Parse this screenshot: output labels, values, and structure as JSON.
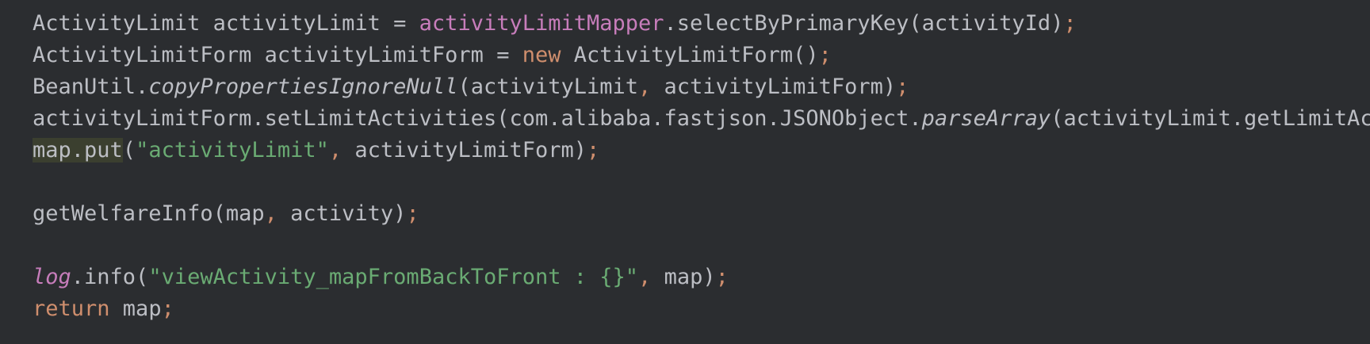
{
  "editor": {
    "colors": {
      "background": "#2b2d30",
      "plain": "#bcbec4",
      "field": "#c77dbb",
      "keyword": "#cf8e6d",
      "string": "#6aab73",
      "highlight": "#3b3f2f"
    },
    "lines": [
      {
        "tokens": [
          {
            "text": "ActivityLimit activityLimit = ",
            "kind": "plain"
          },
          {
            "text": "activityLimitMapper",
            "kind": "field"
          },
          {
            "text": ".selectByPrimaryKey(activityId)",
            "kind": "plain"
          },
          {
            "text": ";",
            "kind": "punct"
          }
        ]
      },
      {
        "tokens": [
          {
            "text": "ActivityLimitForm activityLimitForm = ",
            "kind": "plain"
          },
          {
            "text": "new",
            "kind": "kw"
          },
          {
            "text": " ActivityLimitForm()",
            "kind": "plain"
          },
          {
            "text": ";",
            "kind": "punct"
          }
        ]
      },
      {
        "tokens": [
          {
            "text": "BeanUtil.",
            "kind": "plain"
          },
          {
            "text": "copyPropertiesIgnoreNull",
            "kind": "italic"
          },
          {
            "text": "(activityLimit",
            "kind": "plain"
          },
          {
            "text": ",",
            "kind": "punct"
          },
          {
            "text": " activityLimitForm)",
            "kind": "plain"
          },
          {
            "text": ";",
            "kind": "punct"
          }
        ]
      },
      {
        "tokens": [
          {
            "text": "activityLimitForm.setLimitActivities(com.alibaba.fastjson.JSONObject.",
            "kind": "plain"
          },
          {
            "text": "parseArray",
            "kind": "italic"
          },
          {
            "text": "(activityLimit.getLimitActivit",
            "kind": "plain"
          }
        ]
      },
      {
        "tokens": [
          {
            "text": "map.put",
            "kind": "hl"
          },
          {
            "text": "(",
            "kind": "plain"
          },
          {
            "text": "\"activityLimit\"",
            "kind": "str"
          },
          {
            "text": ",",
            "kind": "punct"
          },
          {
            "text": " activityLimitForm)",
            "kind": "plain"
          },
          {
            "text": ";",
            "kind": "punct"
          }
        ]
      },
      {
        "tokens": []
      },
      {
        "tokens": [
          {
            "text": "getWelfareInfo(map",
            "kind": "plain"
          },
          {
            "text": ",",
            "kind": "punct"
          },
          {
            "text": " activity)",
            "kind": "plain"
          },
          {
            "text": ";",
            "kind": "punct"
          }
        ]
      },
      {
        "tokens": []
      },
      {
        "tokens": [
          {
            "text": "log",
            "kind": "static-field"
          },
          {
            "text": ".info(",
            "kind": "plain"
          },
          {
            "text": "\"viewActivity_mapFromBackToFront : {}\"",
            "kind": "str"
          },
          {
            "text": ",",
            "kind": "punct"
          },
          {
            "text": " map)",
            "kind": "plain"
          },
          {
            "text": ";",
            "kind": "punct"
          }
        ]
      },
      {
        "tokens": [
          {
            "text": "return",
            "kind": "kw"
          },
          {
            "text": " map",
            "kind": "plain"
          },
          {
            "text": ";",
            "kind": "punct"
          }
        ]
      }
    ]
  }
}
